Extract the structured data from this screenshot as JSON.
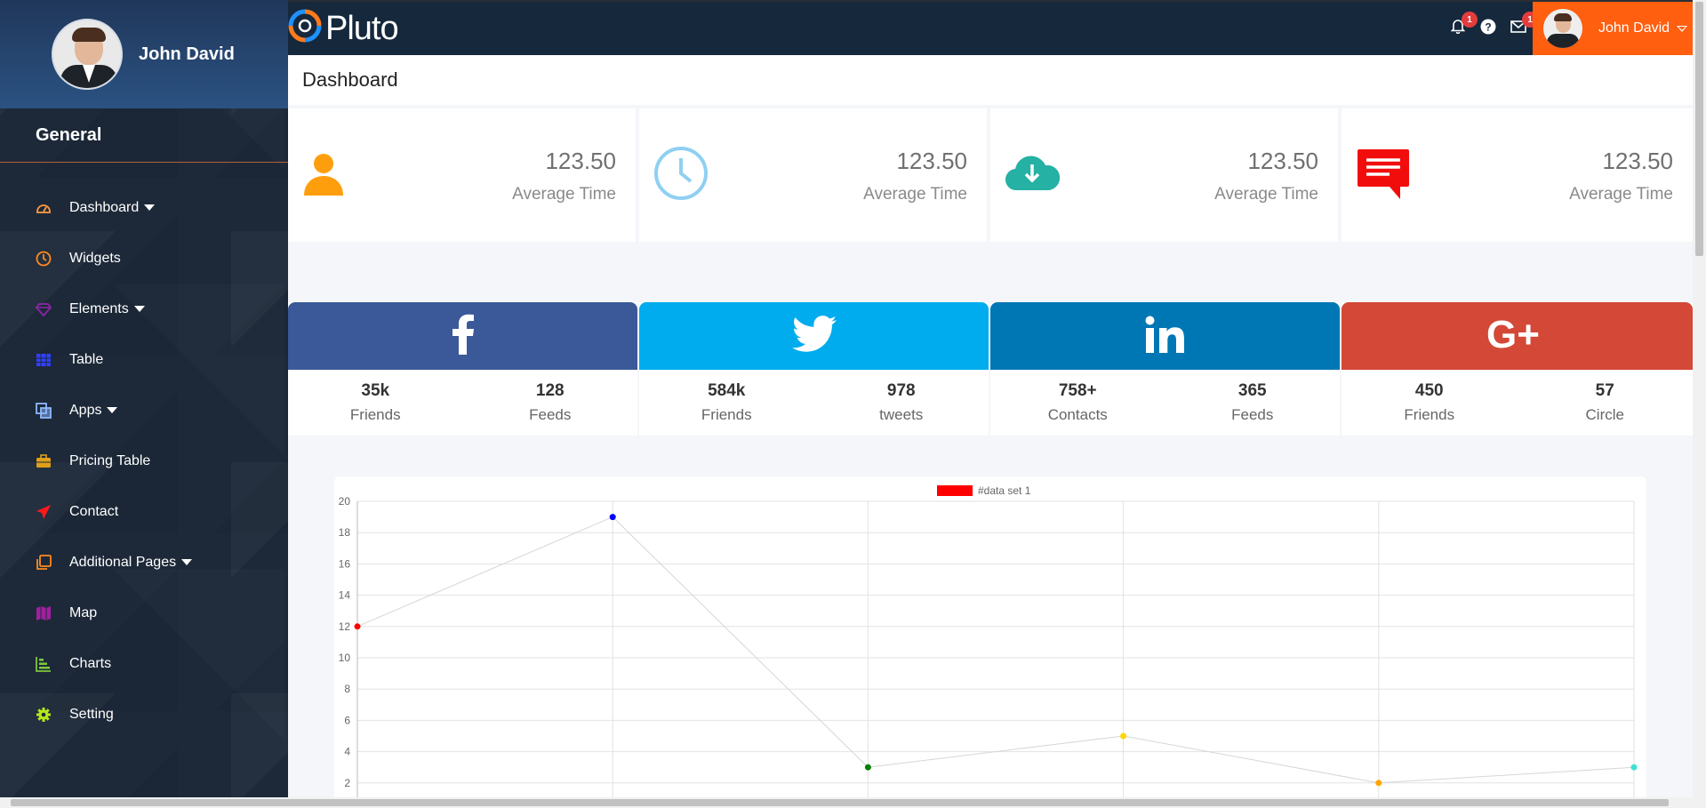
{
  "sidebar": {
    "user_name": "John David",
    "section_title": "General",
    "items": [
      {
        "label": "Dashboard",
        "icon": "dashboard-icon",
        "dropdown": true,
        "color": "#ff9a3c"
      },
      {
        "label": "Widgets",
        "icon": "clock-icon",
        "dropdown": false,
        "color": "#ff8a1f"
      },
      {
        "label": "Elements",
        "icon": "diamond-icon",
        "dropdown": true,
        "color": "#8e24aa"
      },
      {
        "label": "Table",
        "icon": "table-icon",
        "dropdown": false,
        "color": "#3040ff"
      },
      {
        "label": "Apps",
        "icon": "apps-icon",
        "dropdown": true,
        "color": "#8fb7ff"
      },
      {
        "label": "Pricing Table",
        "icon": "briefcase-icon",
        "dropdown": false,
        "color": "#e0a019"
      },
      {
        "label": "Contact",
        "icon": "paper-plane-icon",
        "dropdown": false,
        "color": "#ff1a1a"
      },
      {
        "label": "Additional Pages",
        "icon": "pages-icon",
        "dropdown": true,
        "color": "#ff8a1f"
      },
      {
        "label": "Map",
        "icon": "map-icon",
        "dropdown": false,
        "color": "#a020a0"
      },
      {
        "label": "Charts",
        "icon": "bar-chart-icon",
        "dropdown": false,
        "color": "#7ec83a"
      },
      {
        "label": "Setting",
        "icon": "gear-icon",
        "dropdown": false,
        "color": "#b4e81a"
      }
    ]
  },
  "topbar": {
    "logo_text": "Pluto",
    "notifications_count": "1",
    "messages_count": "1",
    "user_name": "John David"
  },
  "main": {
    "page_title": "Dashboard",
    "stats": [
      {
        "value": "123.50",
        "label": "Average Time",
        "icon": "user-icon",
        "color": "#ff9e0d"
      },
      {
        "value": "123.50",
        "label": "Average Time",
        "icon": "clock-icon",
        "color": "#8fd0f2"
      },
      {
        "value": "123.50",
        "label": "Average Time",
        "icon": "cloud-download-icon",
        "color": "#25b1a4"
      },
      {
        "value": "123.50",
        "label": "Average Time",
        "icon": "comment-icon",
        "color": "#f20d0d"
      }
    ],
    "socials": [
      {
        "network": "facebook-icon",
        "color": "#3b5998",
        "stats": [
          {
            "value": "35k",
            "label": "Friends"
          },
          {
            "value": "128",
            "label": "Feeds"
          }
        ]
      },
      {
        "network": "twitter-icon",
        "color": "#00aced",
        "stats": [
          {
            "value": "584k",
            "label": "Friends"
          },
          {
            "value": "978",
            "label": "tweets"
          }
        ]
      },
      {
        "network": "linkedin-icon",
        "color": "#0077b5",
        "stats": [
          {
            "value": "758+",
            "label": "Contacts"
          },
          {
            "value": "365",
            "label": "Feeds"
          }
        ]
      },
      {
        "network": "google-plus-icon",
        "color": "#d34836",
        "stats": [
          {
            "value": "450",
            "label": "Friends"
          },
          {
            "value": "57",
            "label": "Circle"
          }
        ]
      }
    ]
  },
  "chart_data": {
    "type": "line",
    "title": "",
    "xlabel": "",
    "ylabel": "",
    "legend": [
      "#data set 1"
    ],
    "legend_position": "top",
    "ylim": [
      0,
      20
    ],
    "yticks": [
      2,
      4,
      6,
      8,
      10,
      12,
      14,
      16,
      18,
      20
    ],
    "grid": true,
    "series": [
      {
        "name": "#data set 1",
        "values": [
          12,
          19,
          3,
          5,
          2,
          3
        ],
        "point_colors": [
          "#ff0000",
          "#0000ff",
          "#008000",
          "#ffd700",
          "#ffa500",
          "#40e0d0"
        ],
        "line_color": "#d6d6d6",
        "legend_color": "#ff0000"
      }
    ]
  }
}
